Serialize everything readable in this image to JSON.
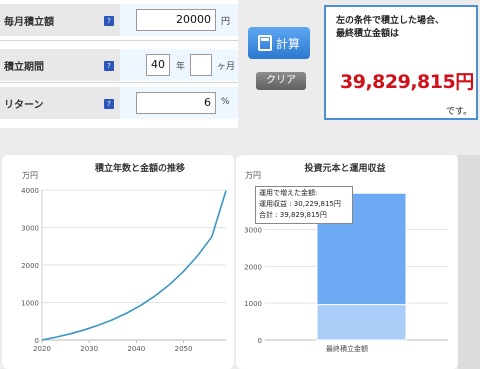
{
  "form": {
    "monthly": {
      "label": "毎月積立額",
      "value": "20000",
      "unit": "円"
    },
    "period": {
      "label": "積立期間",
      "years": "40",
      "years_unit": "年",
      "months": "",
      "months_unit": "ヶ月"
    },
    "return": {
      "label": "リターン",
      "value": "6",
      "unit": "%"
    },
    "help_icon": "?"
  },
  "buttons": {
    "calc": "計算",
    "clear": "クリア"
  },
  "result": {
    "description": "左の条件で積立した場合、\n最終積立金額は",
    "value": "39,829,815円",
    "suffix": "です。"
  },
  "chart_data": [
    {
      "type": "line",
      "title": "積立年数と金額の推移",
      "ylabel": "万円",
      "xlim": [
        2020,
        2059
      ],
      "ylim": [
        0,
        4000
      ],
      "x_ticks": [
        "2020",
        "2030",
        "2040",
        "2050"
      ],
      "y_ticks": [
        "0",
        "1000",
        "2000",
        "3000",
        "4000"
      ],
      "series": [
        {
          "color": "#3a97c4",
          "x": [
            2020,
            2023,
            2026,
            2029,
            2032,
            2035,
            2038,
            2041,
            2044,
            2047,
            2050,
            2053,
            2056,
            2059
          ],
          "y": [
            0,
            77,
            166,
            271,
            396,
            544,
            720,
            929,
            1178,
            1474,
            1828,
            2250,
            2753,
            3983
          ]
        }
      ]
    },
    {
      "type": "bar",
      "title": "投資元本と運用収益",
      "ylabel": "万円",
      "categories": [
        "最終積立金額"
      ],
      "y_ticks": [
        "0",
        "1000",
        "2000",
        "3000"
      ],
      "ylim": [
        0,
        4180
      ],
      "stacked": true,
      "series": [
        {
          "values": [
            960
          ],
          "color": "#a9cdf7"
        },
        {
          "values": [
            3023
          ],
          "color": "#6eaaf3"
        }
      ],
      "tooltip": {
        "title": "運用で増えた金額:",
        "line1": "運用収益 :  30,229,815円",
        "line2": "合計 :  39,829,815円"
      }
    }
  ]
}
